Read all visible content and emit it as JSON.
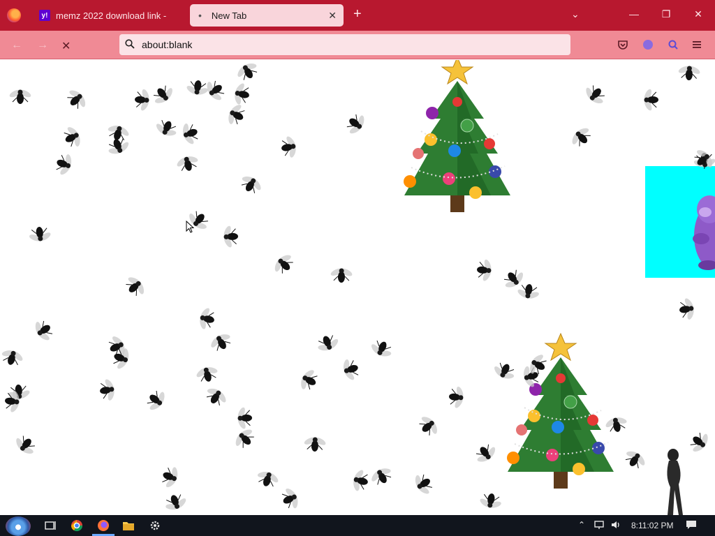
{
  "browser": {
    "tabs": [
      {
        "title": "memz 2022 download link - ",
        "active": false,
        "favicon": "yahoo-icon"
      },
      {
        "title": "New Tab",
        "active": true,
        "favicon": "dot"
      }
    ],
    "address_bar": {
      "value": "about:blank"
    },
    "new_tab_symbol": "+",
    "tab_close_symbol": "✕"
  },
  "taskbar": {
    "apps": [
      "start-button",
      "task-view-icon",
      "chrome-icon",
      "firefox-icon",
      "file-explorer-icon",
      "settings-icon"
    ],
    "clock": "8:11:02 PM",
    "tray_icons": [
      "chevron-up-icon",
      "network-icon",
      "volume-icon",
      "notification-icon"
    ]
  },
  "page": {
    "background": "#ffffff",
    "overlays": [
      "christmas-tree",
      "christmas-tree",
      "bonzi-buddy-window",
      "flies"
    ]
  },
  "colors": {
    "tabstrip": "#b8182f",
    "navbar": "#f08a95",
    "active_tab": "#f9d5db",
    "bonzi_bg": "#00ffff",
    "taskbar": "#11151d"
  }
}
